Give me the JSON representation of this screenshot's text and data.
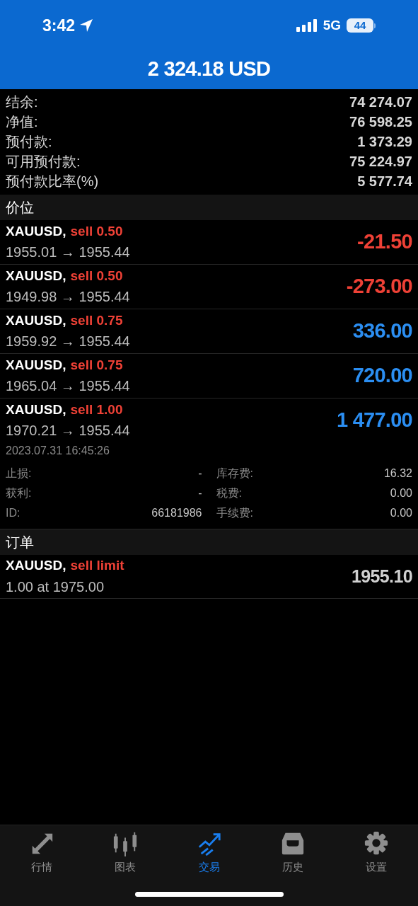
{
  "status_bar": {
    "time": "3:42",
    "network": "5G",
    "battery": "44"
  },
  "header": {
    "title": "2 324.18 USD"
  },
  "summary": [
    {
      "label": "结余:",
      "value": "74 274.07"
    },
    {
      "label": "净值:",
      "value": "76 598.25"
    },
    {
      "label": "预付款:",
      "value": "1 373.29"
    },
    {
      "label": "可用预付款:",
      "value": "75 224.97"
    },
    {
      "label": "预付款比率(%)",
      "value": "5 577.74"
    }
  ],
  "positions_section": {
    "title": "价位"
  },
  "positions": [
    {
      "symbol": "XAUUSD,",
      "side": "sell 0.50",
      "prices": "1955.01 → 1955.44",
      "profit": "-21.50",
      "color": "#ef4136",
      "expanded": false
    },
    {
      "symbol": "XAUUSD,",
      "side": "sell 0.50",
      "prices": "1949.98 → 1955.44",
      "profit": "-273.00",
      "color": "#ef4136",
      "expanded": false
    },
    {
      "symbol": "XAUUSD,",
      "side": "sell 0.75",
      "prices": "1959.92 → 1955.44",
      "profit": "336.00",
      "color": "#2b8ef2",
      "expanded": false
    },
    {
      "symbol": "XAUUSD,",
      "side": "sell 0.75",
      "prices": "1965.04 → 1955.44",
      "profit": "720.00",
      "color": "#2b8ef2",
      "expanded": false
    },
    {
      "symbol": "XAUUSD,",
      "side": "sell 1.00",
      "prices": "1970.21 → 1955.44",
      "profit": "1 477.00",
      "color": "#2b8ef2",
      "expanded": true,
      "time": "2023.07.31 16:45:26",
      "details": [
        {
          "label": "止损:",
          "value": "-"
        },
        {
          "label": "库存费:",
          "value": "16.32"
        },
        {
          "label": "获利:",
          "value": "-"
        },
        {
          "label": "税费:",
          "value": "0.00"
        },
        {
          "label": "ID:",
          "value": "66181986"
        },
        {
          "label": "手续费:",
          "value": "0.00"
        }
      ]
    }
  ],
  "orders_section": {
    "title": "订单"
  },
  "orders": [
    {
      "symbol": "XAUUSD,",
      "side": "sell limit",
      "detail": "1.00 at 1975.00",
      "price": "1955.10"
    }
  ],
  "tabs": [
    {
      "label": "行情",
      "kind": "arrows",
      "selected": false
    },
    {
      "label": "图表",
      "kind": "candles",
      "selected": false
    },
    {
      "label": "交易",
      "kind": "trend",
      "selected": true
    },
    {
      "label": "历史",
      "kind": "tray",
      "selected": false
    },
    {
      "label": "设置",
      "kind": "gear",
      "selected": false
    }
  ]
}
